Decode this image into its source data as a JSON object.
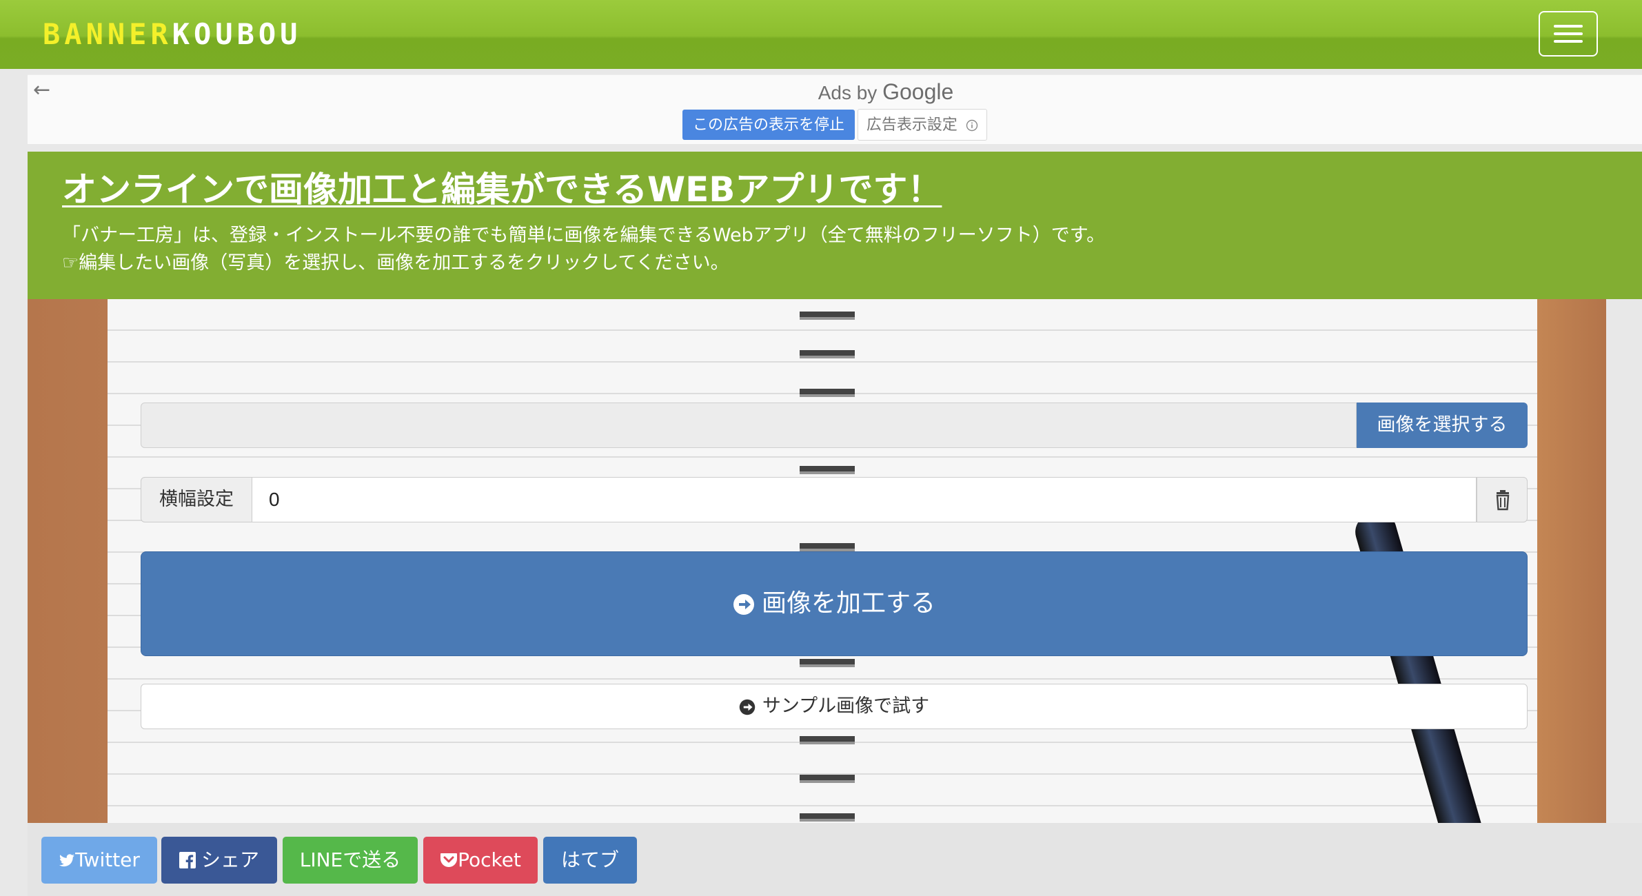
{
  "header": {
    "logo_part1": "BANNER",
    "logo_part2": "KOUBOU",
    "menu_icon": "hamburger-icon"
  },
  "ad": {
    "back_icon": "arrow-left-icon",
    "ads_by": "Ads by ",
    "google": "Google",
    "stop_label": "この広告の表示を停止",
    "settings_label": "広告表示設定",
    "info_icon": "info-icon"
  },
  "hero": {
    "title": "オンラインで画像加工と編集ができるWEBアプリです！",
    "line1": "「バナー工房」は、登録・インストール不要の誰でも簡単に画像を編集できるWebアプリ（全て無料のフリーソフト）です。",
    "line2": "☞編集したい画像（写真）を選択し、画像を加工するをクリックしてください。"
  },
  "form": {
    "file_placeholder": "",
    "select_label": "画像を選択する",
    "width_label": "横幅設定",
    "width_value": "0",
    "trash_icon": "trash-icon",
    "process_label": "画像を加工する",
    "sample_label": "サンプル画像で試す"
  },
  "share": {
    "twitter": "Twitter",
    "facebook": "シェア",
    "line": "LINEで送る",
    "pocket": "Pocket",
    "hatena": "はてブ"
  }
}
